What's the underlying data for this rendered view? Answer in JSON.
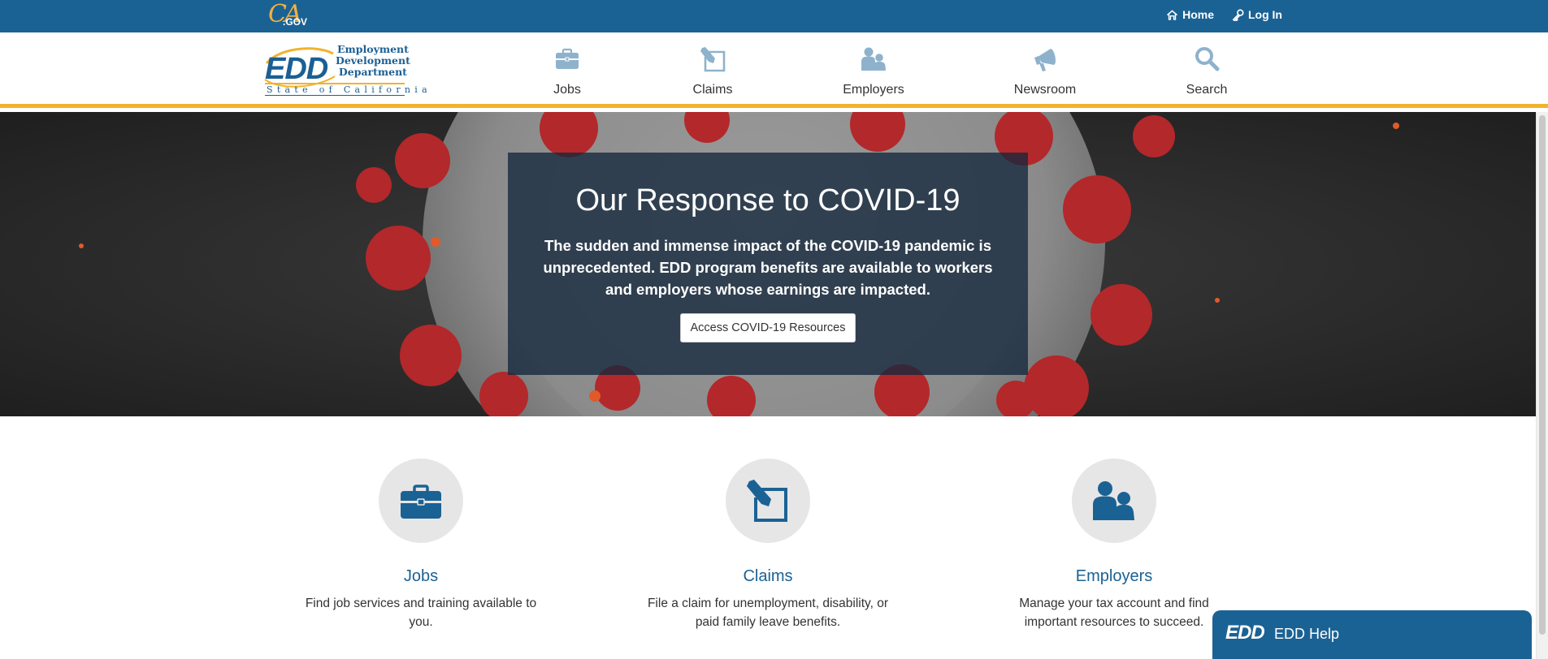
{
  "utility_bar": {
    "cagov_ca": "CA",
    "cagov_gov": ".GOV",
    "links": [
      {
        "label": "Home",
        "icon": "home-icon"
      },
      {
        "label": "Log In",
        "icon": "key-icon"
      }
    ]
  },
  "logo": {
    "abbr": "EDD",
    "line1": "Employment",
    "line2": "Development",
    "line3": "Department",
    "state": "State of California"
  },
  "nav": [
    {
      "label": "Jobs",
      "icon": "briefcase-icon"
    },
    {
      "label": "Claims",
      "icon": "pencil-square-icon"
    },
    {
      "label": "Employers",
      "icon": "people-icon"
    },
    {
      "label": "Newsroom",
      "icon": "megaphone-icon"
    },
    {
      "label": "Search",
      "icon": "search-icon"
    }
  ],
  "hero": {
    "title": "Our Response to COVID-19",
    "text": "The sudden and immense impact of the COVID-19 pandemic is unprecedented. EDD program benefits are available to workers and employers whose earnings are impacted.",
    "button": "Access COVID-19 Resources"
  },
  "cards": [
    {
      "title": "Jobs",
      "desc": "Find job services and training available to you.",
      "icon": "briefcase-icon"
    },
    {
      "title": "Claims",
      "desc": "File a claim for unemployment, disability, or paid family leave benefits.",
      "icon": "pencil-square-icon"
    },
    {
      "title": "Employers",
      "desc": "Manage your tax account and find important resources to succeed.",
      "icon": "people-icon"
    }
  ],
  "help": {
    "logo": "EDD",
    "label": "EDD Help"
  },
  "colors": {
    "primary_blue": "#1b6294",
    "accent_gold": "#f2b32c",
    "nav_icon": "#7fa9c8"
  }
}
